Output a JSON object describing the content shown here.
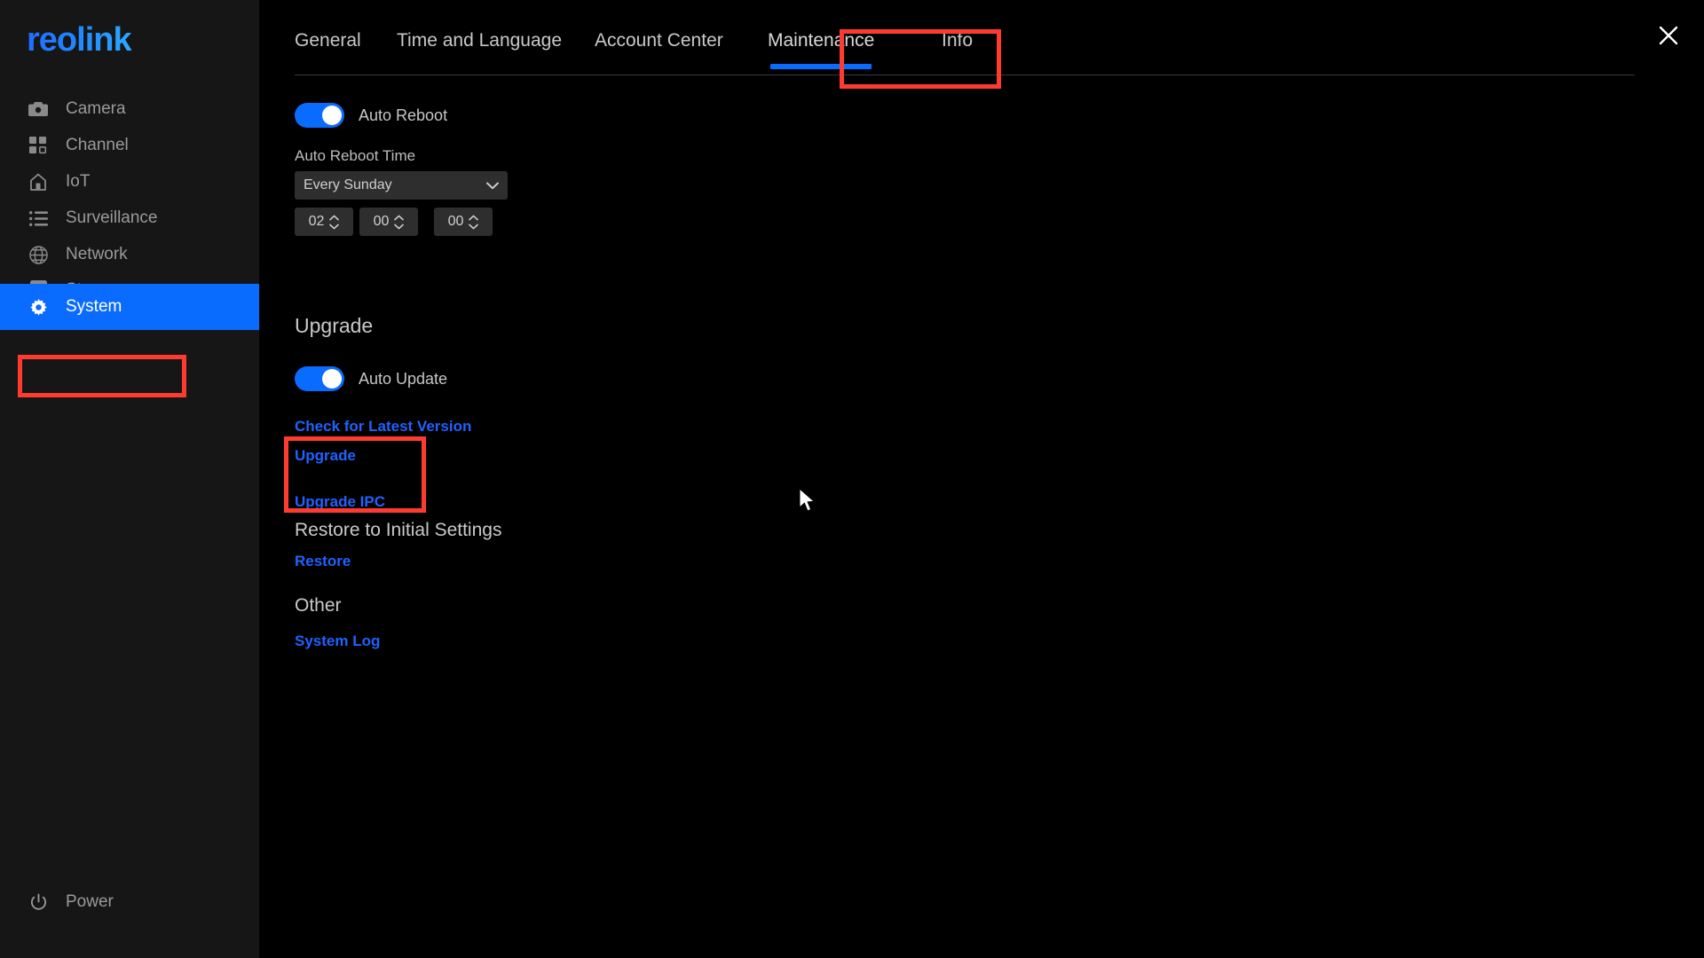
{
  "app": {
    "logo_text": "reolink",
    "close_label": "×"
  },
  "sidebar": {
    "items": [
      {
        "label": "Camera",
        "icon": "camera-icon",
        "active": false
      },
      {
        "label": "Channel",
        "icon": "grid-icon",
        "active": false
      },
      {
        "label": "IoT",
        "icon": "home-icon",
        "active": false
      },
      {
        "label": "Surveillance",
        "icon": "list-icon",
        "active": false
      },
      {
        "label": "Network",
        "icon": "globe-icon",
        "active": false
      },
      {
        "label": "Storage",
        "icon": "harddrive-icon",
        "active": false
      },
      {
        "label": "System",
        "icon": "gear-icon",
        "active": true
      }
    ],
    "power": {
      "label": "Power",
      "icon": "power-icon"
    }
  },
  "tabs": [
    {
      "label": "General",
      "active": false
    },
    {
      "label": "Time and Language",
      "active": false
    },
    {
      "label": "Account Center",
      "active": false
    },
    {
      "label": "Maintenance",
      "active": true
    },
    {
      "label": "Info",
      "active": false
    }
  ],
  "maintenance": {
    "auto_reboot": {
      "toggle_label": "Auto Reboot",
      "toggle_state": "on",
      "time_label": "Auto Reboot Time",
      "day_value": "Every Sunday",
      "hour": "02",
      "minute": "00",
      "second": "00"
    },
    "upgrade": {
      "heading": "Upgrade",
      "auto_update_label": "Auto Update",
      "auto_update_state": "on",
      "check_link": "Check for Latest Version",
      "upgrade_link": "Upgrade",
      "upgrade_ipc_link": "Upgrade IPC"
    },
    "restore": {
      "heading": "Restore to Initial Settings",
      "link": "Restore"
    },
    "other": {
      "heading": "Other",
      "link": "System Log"
    }
  },
  "colors": {
    "accent_blue": "#0a6cff",
    "link_blue": "#1f62ff",
    "annotation_red": "#ff3b30",
    "sidebar_bg": "#161616",
    "panel_bg": "#000000"
  }
}
